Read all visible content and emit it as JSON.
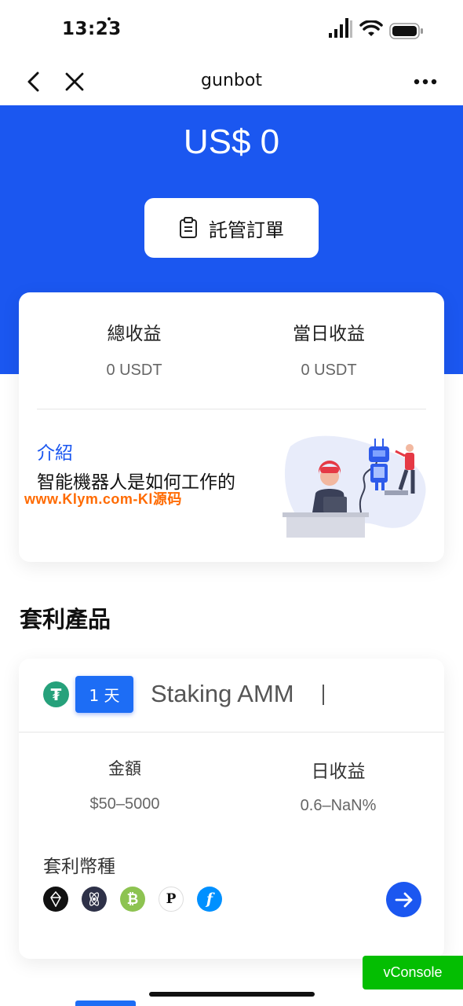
{
  "status_bar": {
    "time": "13:23"
  },
  "nav": {
    "title": "gunbot"
  },
  "hero": {
    "amount": "US$ 0",
    "orders_button": "託管訂單"
  },
  "stats": {
    "total_label": "總收益",
    "total_value": "0 USDT",
    "daily_label": "當日收益",
    "daily_value": "0 USDT"
  },
  "intro": {
    "title": "介紹",
    "text": "智能機器人是如何工作的",
    "watermark": "www.Klym.com-Kl源码"
  },
  "section": {
    "title": "套利產品"
  },
  "product": {
    "badge": "1 天",
    "name": "Staking AMM",
    "amount_label": "金額",
    "amount_value": "$50–5000",
    "daily_label": "日收益",
    "daily_value": "0.6–NaN%",
    "coins_label": "套利幣種",
    "coins": [
      "eos-icon",
      "cosmos-icon",
      "bitcoin-cash-icon",
      "polkadot-icon",
      "filecoin-icon"
    ]
  },
  "vconsole": {
    "label": "vConsole"
  },
  "colors": {
    "primary": "#1b57f0",
    "tether": "#26a17b",
    "vconsole": "#04be02"
  }
}
